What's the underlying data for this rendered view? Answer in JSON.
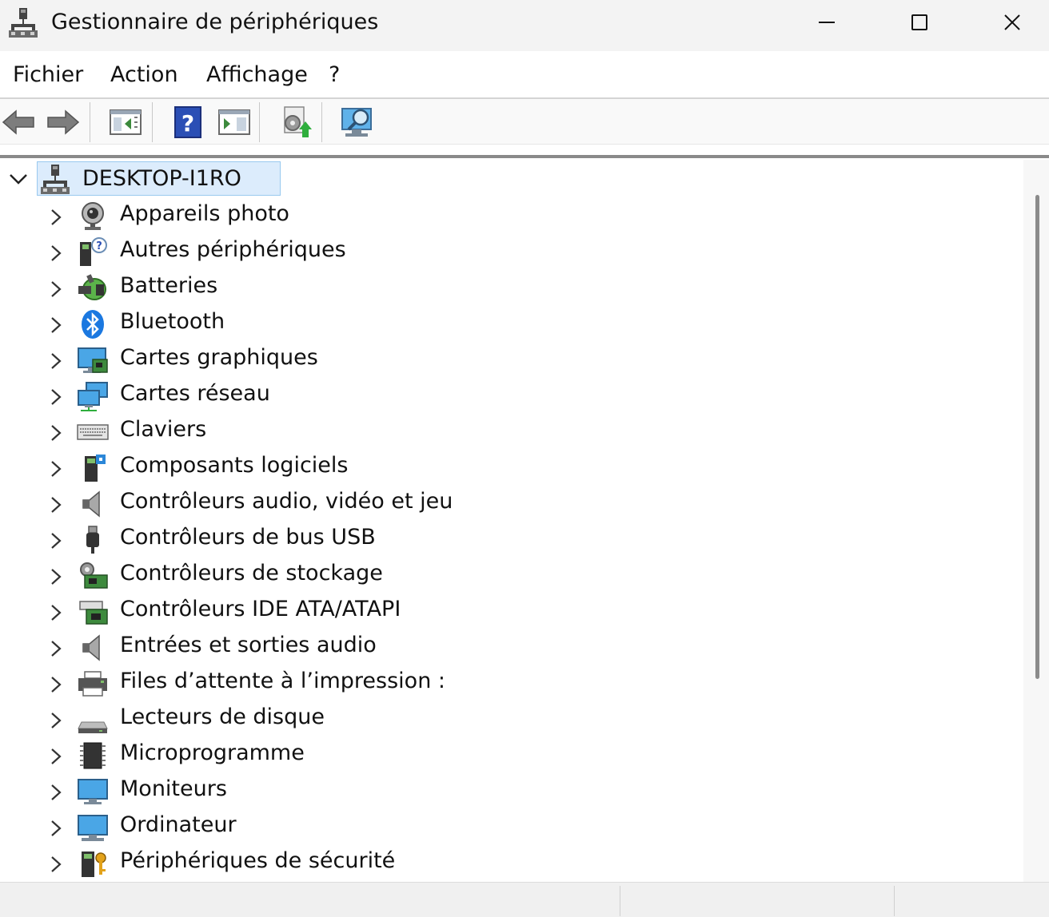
{
  "window": {
    "title": "Gestionnaire de périphériques",
    "controls": {
      "minimize": "minimize-icon",
      "maximize": "maximize-icon",
      "close": "close-icon"
    }
  },
  "menu": {
    "items": [
      {
        "label": "Fichier"
      },
      {
        "label": "Action"
      },
      {
        "label": "Affichage"
      },
      {
        "label": "?"
      }
    ]
  },
  "toolbar": {
    "buttons": [
      {
        "icon": "back-arrow-icon"
      },
      {
        "icon": "forward-arrow-icon"
      },
      {
        "icon": "show-hide-console-tree-icon"
      },
      {
        "icon": "help-icon"
      },
      {
        "icon": "show-action-pane-icon"
      },
      {
        "icon": "update-driver-icon"
      },
      {
        "icon": "scan-hardware-changes-icon"
      }
    ]
  },
  "tree": {
    "root": {
      "label": "DESKTOP-I1RO",
      "icon": "computer-network-icon",
      "expanded": true
    },
    "nodes": [
      {
        "label": "Appareils photo",
        "icon": "webcam-icon"
      },
      {
        "label": "Autres périphériques",
        "icon": "unknown-device-icon"
      },
      {
        "label": "Batteries",
        "icon": "battery-icon"
      },
      {
        "label": "Bluetooth",
        "icon": "bluetooth-icon"
      },
      {
        "label": "Cartes graphiques",
        "icon": "display-adapter-icon"
      },
      {
        "label": "Cartes réseau",
        "icon": "network-adapter-icon"
      },
      {
        "label": "Claviers",
        "icon": "keyboard-icon"
      },
      {
        "label": "Composants logiciels",
        "icon": "software-component-icon"
      },
      {
        "label": "Contrôleurs audio, vidéo et jeu",
        "icon": "speaker-icon"
      },
      {
        "label": "Contrôleurs de bus USB",
        "icon": "usb-icon"
      },
      {
        "label": "Contrôleurs de stockage",
        "icon": "storage-controller-icon"
      },
      {
        "label": "Contrôleurs IDE ATA/ATAPI",
        "icon": "ide-controller-icon"
      },
      {
        "label": "Entrées et sorties audio",
        "icon": "audio-io-icon"
      },
      {
        "label": "Files d’attente à l’impression :",
        "icon": "printer-icon"
      },
      {
        "label": "Lecteurs de disque",
        "icon": "disk-drive-icon"
      },
      {
        "label": "Microprogramme",
        "icon": "firmware-chip-icon"
      },
      {
        "label": "Moniteurs",
        "icon": "monitor-icon"
      },
      {
        "label": "Ordinateur",
        "icon": "computer-icon"
      },
      {
        "label": "Périphériques de sécurité",
        "icon": "security-key-icon"
      }
    ]
  }
}
